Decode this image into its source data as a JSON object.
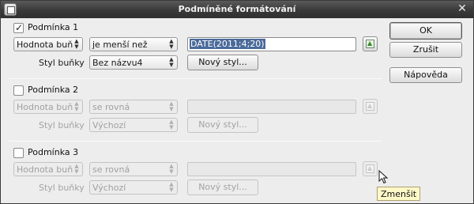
{
  "window": {
    "title": "Podmíněné formátování"
  },
  "conditions": [
    {
      "label": "Podmínka 1",
      "checked": true,
      "enabled": true,
      "type": "Hodnota buň",
      "operator": "je menší než",
      "value": "DATE(2011;4;20)",
      "style_label": "Styl buňky",
      "style": "Bez názvu4",
      "new_style_button": "Nový styl..."
    },
    {
      "label": "Podmínka 2",
      "checked": false,
      "enabled": false,
      "type": "Hodnota buň",
      "operator": "se rovná",
      "value": "",
      "style_label": "Styl buňky",
      "style": "Výchozí",
      "new_style_button": "Nový styl..."
    },
    {
      "label": "Podmínka 3",
      "checked": false,
      "enabled": false,
      "type": "Hodnota buň",
      "operator": "se rovná",
      "value": "",
      "style_label": "Styl buňky",
      "style": "Výchozí",
      "new_style_button": "Nový styl..."
    }
  ],
  "buttons": {
    "ok": "OK",
    "cancel": "Zrušit",
    "help": "Nápověda"
  },
  "tooltip": "Zmenšit",
  "icons": {
    "close": "close-icon",
    "shrink": "shrink-icon",
    "spin": "spin-arrows-icon",
    "check": "checkmark-icon",
    "cursor": "mouse-cursor-icon"
  }
}
